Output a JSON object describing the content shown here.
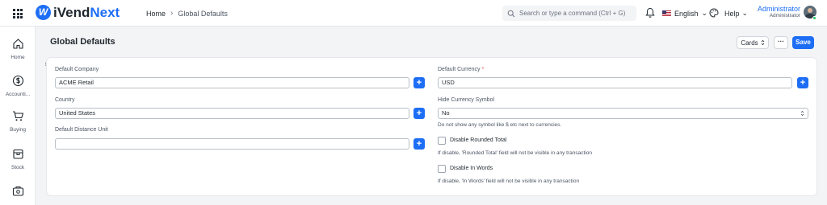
{
  "app": {
    "logo_mark": "W",
    "logo_a": "iVend",
    "logo_b": "Next"
  },
  "breadcrumb": {
    "home": "Home",
    "separator": "›",
    "current": "Global Defaults"
  },
  "search": {
    "placeholder": "Search or type a command (Ctrl + G)"
  },
  "topbar": {
    "language": "English",
    "help": "Help",
    "caret": "⌄"
  },
  "user": {
    "name": "Administrator",
    "role": "Administrator"
  },
  "sidebar": {
    "items": [
      {
        "label": "Home",
        "icon": "home-icon"
      },
      {
        "label": "Accounti...",
        "icon": "dollar-icon"
      },
      {
        "label": "Buying",
        "icon": "cart-icon"
      },
      {
        "label": "Stock",
        "icon": "box-icon"
      },
      {
        "label": "",
        "icon": "register-icon"
      }
    ]
  },
  "page": {
    "title": "Global Defaults",
    "cards_label": "Cards",
    "more_label": "···",
    "save_label": "Save",
    "toggle": "›"
  },
  "form": {
    "default_company": {
      "label": "Default Company",
      "value": "ACME Retail"
    },
    "country": {
      "label": "Country",
      "value": "United States"
    },
    "default_distance_unit": {
      "label": "Default Distance Unit",
      "value": ""
    },
    "default_currency": {
      "label": "Default Currency",
      "required_mark": "*",
      "value": "USD"
    },
    "hide_currency_symbol": {
      "label": "Hide Currency Symbol",
      "value": "No",
      "description": "Do not show any symbol like $ etc next to currencies."
    },
    "disable_rounded_total": {
      "label": "Disable Rounded Total",
      "checked": false,
      "description": "If disable, 'Rounded Total' field will not be visible in any transaction"
    },
    "disable_in_words": {
      "label": "Disable In Words",
      "checked": false,
      "description": "If disable, 'In Words' field will not be visible in any transaction"
    },
    "add_symbol": "+"
  },
  "colors": {
    "accent": "#1d6ef5",
    "online": "#22c55e",
    "required": "#e24c4c"
  }
}
